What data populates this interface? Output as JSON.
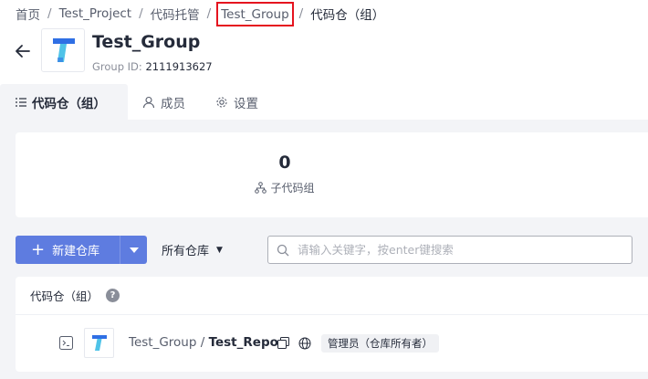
{
  "breadcrumb": {
    "items": [
      "首页",
      "Test_Project",
      "代码托管",
      "Test_Group",
      "代码仓（组）"
    ],
    "separator": "/"
  },
  "header": {
    "title": "Test_Group",
    "group_id_label": "Group ID:",
    "group_id_value": "2111913627"
  },
  "tabs": [
    {
      "label": "代码仓（组）",
      "icon": "list-icon",
      "active": true
    },
    {
      "label": "成员",
      "icon": "user-icon",
      "active": false
    },
    {
      "label": "设置",
      "icon": "gear-icon",
      "active": false
    }
  ],
  "stats": {
    "count": "0",
    "label": "子代码组",
    "icon": "subgroup-icon"
  },
  "toolbar": {
    "new_repo_label": "新建仓库",
    "filter_label": "所有仓库",
    "search_placeholder": "请输入关键字，按enter键搜索"
  },
  "list": {
    "header": "代码仓（组）",
    "help": "?",
    "rows": [
      {
        "group": "Test_Group",
        "slash": " / ",
        "repo": "Test_Repo",
        "role": "管理员（仓库所有者）"
      }
    ]
  },
  "colors": {
    "primary": "#5e7ce0",
    "highlight_box": "#e5141f",
    "logo_blue": "#2f6fe4",
    "logo_cyan": "#4fc3e8"
  }
}
